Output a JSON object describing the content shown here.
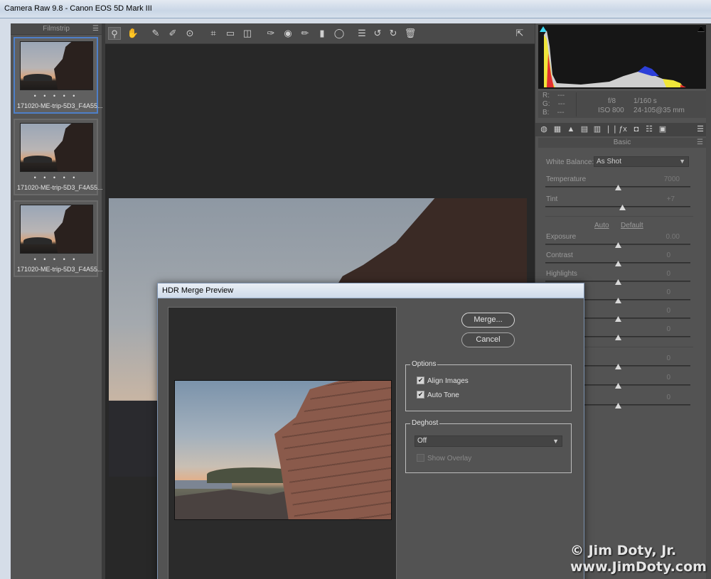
{
  "window": {
    "title": "Camera Raw 9.8  -  Canon EOS 5D Mark III"
  },
  "filmstrip": {
    "title": "Filmstrip",
    "items": [
      {
        "name": "171020-ME-trip-5D3_F4A55...",
        "rating": "• • • • •",
        "selected": true
      },
      {
        "name": "171020-ME-trip-5D3_F4A55...",
        "rating": "• • • • •",
        "selected": false
      },
      {
        "name": "171020-ME-trip-5D3_F4A55...",
        "rating": "• • • • •",
        "selected": false
      }
    ]
  },
  "toolbar": {
    "tools": [
      "zoom-icon",
      "hand-icon",
      "white-balance-icon",
      "color-sampler-icon",
      "targeted-adjustment-icon",
      "crop-icon",
      "straighten-icon",
      "transform-icon",
      "spot-removal-icon",
      "red-eye-icon",
      "adjustment-brush-icon",
      "graduated-filter-icon",
      "radial-filter-icon",
      "preferences-icon",
      "rotate-left-icon",
      "rotate-right-icon",
      "trash-icon"
    ],
    "fullscreen_icon": "fullscreen-icon"
  },
  "readout": {
    "r_label": "R:",
    "r_value": "---",
    "g_label": "G:",
    "g_value": "---",
    "b_label": "B:",
    "b_value": "---",
    "aperture": "f/8",
    "shutter": "1/160 s",
    "iso": "ISO 800",
    "lens": "24-105@35 mm"
  },
  "panel": {
    "tabs": [
      "basic-icon",
      "tone-curve-icon",
      "detail-icon",
      "hsl-icon",
      "split-toning-icon",
      "lens-corrections-icon",
      "effects-icon",
      "camera-calibration-icon",
      "presets-icon",
      "snapshots-icon"
    ],
    "title": "Basic",
    "white_balance_label": "White Balance:",
    "white_balance_value": "As Shot",
    "temperature_label": "Temperature",
    "temperature_value": "7000",
    "tint_label": "Tint",
    "tint_value": "+7",
    "auto_label": "Auto",
    "default_label": "Default",
    "exposure_label": "Exposure",
    "exposure_value": "0.00",
    "contrast_label": "Contrast",
    "contrast_value": "0",
    "highlights_label": "Highlights",
    "highlights_value": "0",
    "hidden_values": [
      "0",
      "0",
      "0",
      "0",
      "0",
      "0"
    ]
  },
  "dialog": {
    "title": "HDR Merge Preview",
    "merge_label": "Merge...",
    "cancel_label": "Cancel",
    "options_label": "Options",
    "align_images_label": "Align Images",
    "align_images_checked": true,
    "auto_tone_label": "Auto Tone",
    "auto_tone_checked": true,
    "deghost_label": "Deghost",
    "deghost_value": "Off",
    "show_overlay_label": "Show Overlay",
    "show_overlay_checked": false
  },
  "watermark": {
    "line1": "© Jim Doty, Jr.",
    "line2": "www.JimDoty.com"
  },
  "colors": {
    "accent_select": "#4e7fc8",
    "panel_bg": "#535353",
    "preview_bg": "#282828"
  }
}
